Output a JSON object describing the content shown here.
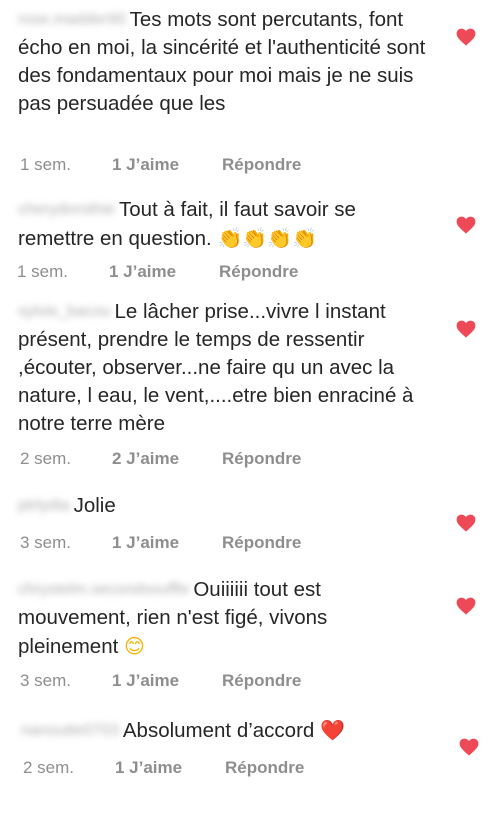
{
  "comments": [
    {
      "username": "rose.madder90",
      "text": "Tes mots sont percutants, font écho en moi, la sincérité et l'authenticité sont des fondamentaux pour moi mais je ne suis pas persuadée que les",
      "time": "1 sem.",
      "likes": "1 J’aime",
      "reply": "Répondre"
    },
    {
      "username": "cherydorothie",
      "text": "Tout à fait, il faut savoir se remettre en question.",
      "emoji": "👏👏👏👏",
      "time": "1 sem.",
      "likes": "1 J’aime",
      "reply": "Répondre"
    },
    {
      "username": "sylvie_bacou",
      "text": "Le lâcher prise...vivre l instant présent, prendre le temps de ressentir ,écouter, observer...ne faire qu un avec la nature, l eau, le vent,....etre bien enraciné à notre terre mère",
      "time": "2 sem.",
      "likes": "2 J’aime",
      "reply": "Répondre"
    },
    {
      "username": "ptrlydia",
      "text": "Jolie",
      "time": "3 sem.",
      "likes": "1 J’aime",
      "reply": "Répondre"
    },
    {
      "username": "chrystelm.secondsouffle",
      "text": "Ouiiiiii tout est mouvement, rien n'est figé, vivons pleinement",
      "emoji": "😊",
      "time": "3 sem.",
      "likes": "1 J’aime",
      "reply": "Répondre"
    },
    {
      "username": "nanoutte0703",
      "text": "Absolument d’accord",
      "emoji": "❤️",
      "time": "2 sem.",
      "likes": "1 J’aime",
      "reply": "Répondre"
    }
  ],
  "colors": {
    "heart": "#ed4956",
    "meta": "#8e8e8e",
    "text": "#262626"
  }
}
